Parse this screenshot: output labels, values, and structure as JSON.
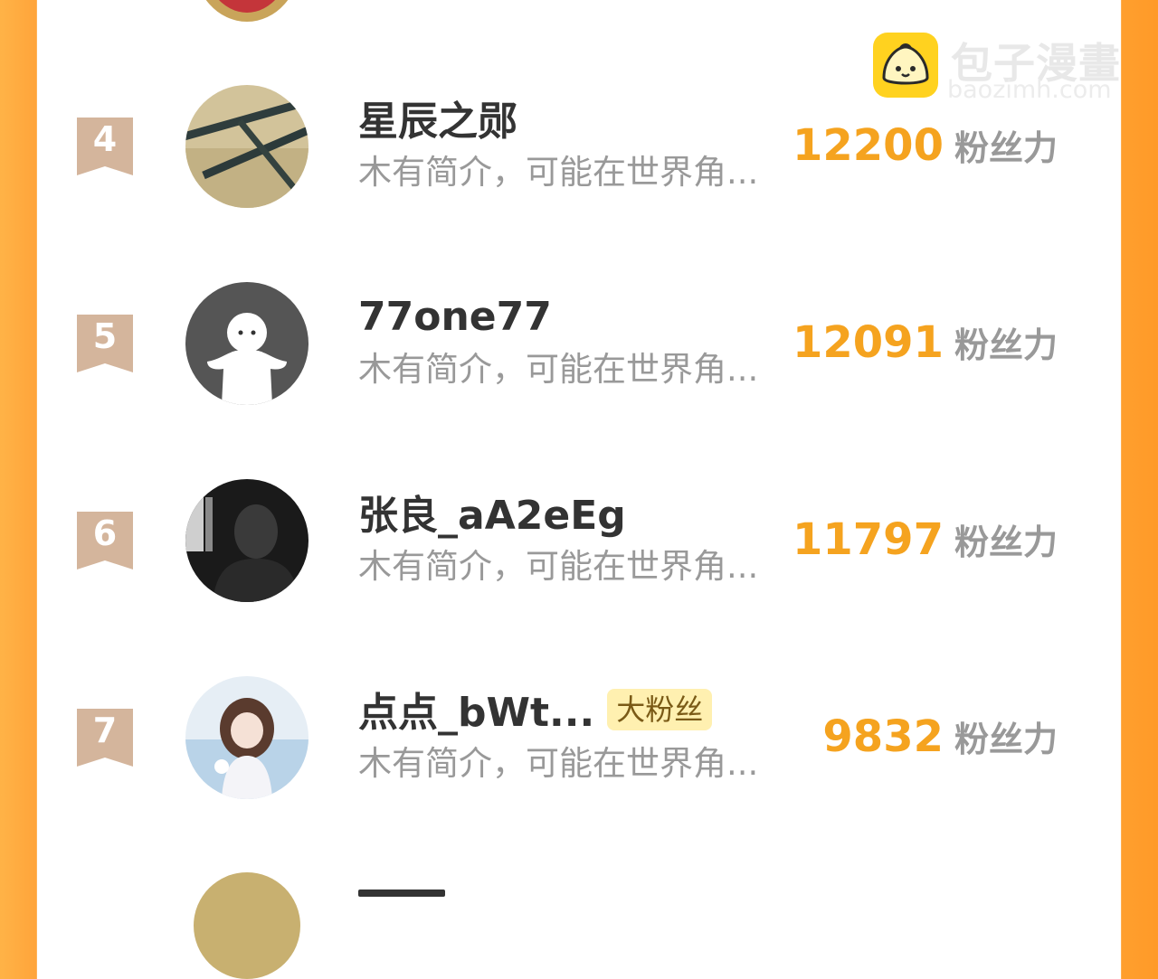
{
  "watermark": {
    "title": "包子漫畫",
    "domain": "baozimh.com",
    "icon": "baozi-logo-icon"
  },
  "score_label": "粉丝力",
  "rows": [
    {
      "rank": "4",
      "name": "星辰之郧",
      "bio": "木有简介，可能在世界角...",
      "score": "12200",
      "badge": ""
    },
    {
      "rank": "5",
      "name": "77one77",
      "bio": "木有简介，可能在世界角...",
      "score": "12091",
      "badge": ""
    },
    {
      "rank": "6",
      "name": "张良_aA2eEg",
      "bio": "木有简介，可能在世界角...",
      "score": "11797",
      "badge": ""
    },
    {
      "rank": "7",
      "name": "点点_bWt...",
      "bio": "木有简介，可能在世界角...",
      "score": "9832",
      "badge": "大粉丝"
    }
  ],
  "colors": {
    "accent": "#f5a31f",
    "border_orange": "#ffa43a",
    "rank_ribbon": "#d4b59c",
    "name_text": "#333333",
    "muted_text": "#999999",
    "badge_bg": "#fff0b0"
  }
}
